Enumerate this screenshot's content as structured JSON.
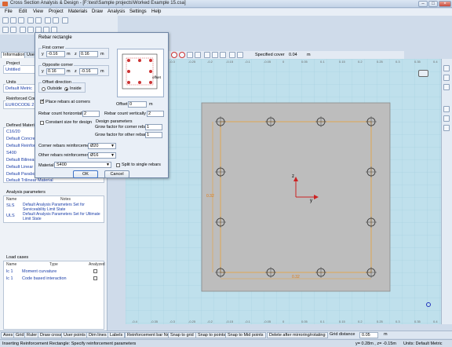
{
  "window": {
    "title": "Cross Section Analysis & Design - [F:\\test\\Sample projects\\Worked Example 15.csa]"
  },
  "menu": [
    "File",
    "Edit",
    "View",
    "Project",
    "Materials",
    "Draw",
    "Analysis",
    "Settings",
    "Help"
  ],
  "left_tabs": [
    "Information",
    "User"
  ],
  "project": {
    "caption": "Project",
    "value": "Untitled"
  },
  "units": {
    "caption": "Units",
    "value": "Default Metric"
  },
  "rc": {
    "caption": "Reinforced Concrete",
    "value": "EUROCODE 2"
  },
  "defined_materials": {
    "caption": "Defined Materials",
    "items": [
      "C16/20",
      "Default Concrete",
      "Default Reinforcing",
      "S400",
      "Default Bilinear Reinforcing",
      "Default Linear Material",
      "Default Parabolic Concrete",
      "Default Trilinear Material"
    ]
  },
  "analysis_params": {
    "caption": "Analysis parameters",
    "col_name": "Name",
    "col_notes": "Notes",
    "rows": [
      {
        "name": "SLS",
        "notes": "Default Analysis Parameters Set for Serviceability Limit State"
      },
      {
        "name": "ULS",
        "notes": "Default Analysis Parameters Set for Ultimate Limit State"
      }
    ]
  },
  "load_cases": {
    "caption": "Load cases",
    "col_name": "Name",
    "col_type": "Type",
    "col_analyzed": "Analyzed",
    "rows": [
      {
        "name": "lc 1",
        "type": "Moment curvature"
      },
      {
        "name": "lc 1",
        "type": "Code based interaction"
      }
    ]
  },
  "dialog": {
    "title": "Rebar rectangle",
    "first_corner": {
      "caption": "First corner",
      "y_label": "y",
      "y": "-0.16",
      "y_unit": "m",
      "z_label": "z",
      "z": "0.16",
      "z_unit": "m"
    },
    "opposite_corner": {
      "caption": "Opposite corner",
      "y_label": "y",
      "y": "0.16",
      "y_unit": "m",
      "z_label": "z",
      "z": "-0.16",
      "z_unit": "m"
    },
    "offset_direction": {
      "caption": "Offset direction",
      "outside": "Outside",
      "inside": "Inside"
    },
    "preview_offset_label": "offset",
    "place_at_corners": "Place rebars at corners",
    "offset_label": "Offset",
    "offset_value": "0",
    "offset_unit": "m",
    "count_h_label": "Rebar count horizontally",
    "count_h": "2",
    "count_v_label": "Rebar count vertically",
    "count_v": "2",
    "constant_size": "Constant size for design",
    "design_params": {
      "caption": "Design parameters",
      "corner_label": "Grow factor for corner rebars",
      "corner_value": "1",
      "other_label": "Grow factor for other rebars",
      "other_value": "1"
    },
    "corner_reinf_label": "Corner rebars reinforcement",
    "corner_reinf": "Ø20",
    "other_reinf_label": "Other rebars reinforcement",
    "other_reinf": "Ø16",
    "material_label": "Material",
    "material": "S400",
    "split_label": "Split to single rebars",
    "ok": "OK",
    "cancel": "Cancel"
  },
  "canvas_toolbar": {
    "specified_cover_label": "Specified cover",
    "specified_cover": "0.04",
    "unit": "m"
  },
  "drawing": {
    "dim_top_left": "0.32",
    "dim_bottom": "0.32",
    "axis_z": "z",
    "axis_y": "y"
  },
  "ruler": {
    "top": [
      "-0.4",
      "-0.35",
      "-0.3",
      "-0.25",
      "-0.2",
      "-0.15",
      "-0.1",
      "-0.05",
      "0",
      "0.05",
      "0.1",
      "0.15",
      "0.2",
      "0.25",
      "0.3",
      "0.35",
      "0.4"
    ]
  },
  "bottom_tabs": [
    "Axes",
    "Grid",
    "Ruler",
    "Draw cross",
    "User points",
    "Dim lines",
    "Labels",
    "Reinforcement bar Nr.",
    "Snap to grid",
    "Snap to points",
    "Snap to Mid points",
    "Delete after mirroring/rotating",
    "Grid distance",
    "0.05",
    "m"
  ],
  "status": {
    "message": "Inserting Reinforcement Rectangle: Specify reinforcement parameters",
    "coords": "y= 0.28m , z= -0.15m",
    "units": "Units: Default Metric"
  }
}
